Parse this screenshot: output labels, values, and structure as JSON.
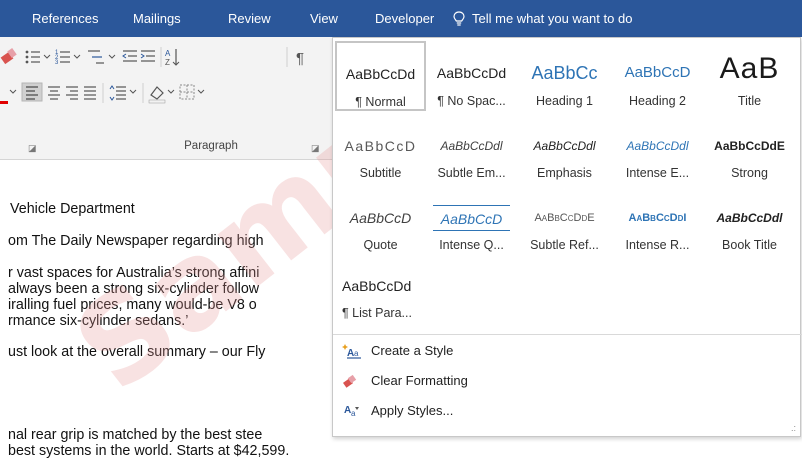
{
  "ribbon_tabs": [
    "References",
    "Mailings",
    "Review",
    "View",
    "Developer"
  ],
  "tell_me": "Tell me what you want to do",
  "paragraph_group_label": "Paragraph",
  "document_lines": [
    "Vehicle Department",
    "om The Daily Newspaper regarding high",
    "r vast spaces for Australia’s strong affini",
    "always been a strong six-cylinder follow",
    "iralling fuel prices, many would-be V8 o",
    "rmance six-cylinder sedans.’",
    "ust look at the overall summary – our Fly",
    "nal rear grip is matched by the best stee",
    "best systems in the world. Starts at $42,599."
  ],
  "styles": [
    {
      "preview": "AaBbCcDd",
      "label": "¶ Normal",
      "selected": true
    },
    {
      "preview": "AaBbCcDd",
      "label": "¶ No Spac..."
    },
    {
      "preview": "AaBbCc",
      "label": "Heading 1"
    },
    {
      "preview": "AaBbCcD",
      "label": "Heading 2"
    },
    {
      "preview": "AaB",
      "label": "Title"
    },
    {
      "preview": "AaBbCcD",
      "label": "Subtitle"
    },
    {
      "preview": "AaBbCcDdl",
      "label": "Subtle Em..."
    },
    {
      "preview": "AaBbCcDdl",
      "label": "Emphasis"
    },
    {
      "preview": "AaBbCcDdl",
      "label": "Intense E..."
    },
    {
      "preview": "AaBbCcDdE",
      "label": "Strong"
    },
    {
      "preview": "AaBbCcD",
      "label": "Quote"
    },
    {
      "preview": "AaBbCcD",
      "label": "Intense Q..."
    },
    {
      "preview": "AaBbCcDdE",
      "label": "Subtle Ref..."
    },
    {
      "preview": "AaBbCcDdI",
      "label": "Intense R..."
    },
    {
      "preview": "AaBbCcDdl",
      "label": "Book Title"
    },
    {
      "preview": "AaBbCcDd",
      "label": "¶ List Para..."
    }
  ],
  "commands": {
    "create_style": "Create a Style",
    "clear_formatting": "Clear Formatting",
    "apply_styles": "Apply Styles..."
  },
  "watermark_text": "Sample",
  "colors": {
    "ribbon_blue": "#2b579a",
    "heading_blue": "#2e74b5"
  }
}
